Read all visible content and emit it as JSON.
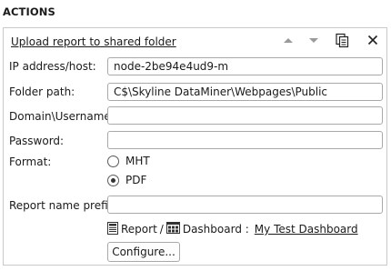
{
  "section": {
    "title": "ACTIONS"
  },
  "action": {
    "title": "Upload report to shared folder",
    "icons": {
      "move_up": "chevron-up-icon",
      "move_down": "chevron-down-icon",
      "duplicate": "copy-icon",
      "delete": "close-icon"
    },
    "icon_color_disabled": "#9a9a9a",
    "icon_color_active": "#222222"
  },
  "form": {
    "ip_label": "IP address/host:",
    "ip_value": "node-2be94e4ud9-m",
    "folder_label": "Folder path:",
    "folder_value": "C$\\Skyline DataMiner\\Webpages\\Public",
    "domain_label": "Domain\\Username:",
    "domain_value": "",
    "password_label": "Password:",
    "password_value": "",
    "format_label": "Format:",
    "format_options": [
      {
        "label": "MHT",
        "selected": false
      },
      {
        "label": "PDF",
        "selected": true
      }
    ],
    "prefix_label": "Report name prefix:",
    "prefix_value": ""
  },
  "dashboard": {
    "report_label": "Report",
    "separator": "/",
    "dashboard_label": "Dashboard :",
    "link_text": "My Test Dashboard",
    "report_icon": "report-icon",
    "dashboard_icon": "dashboard-icon"
  },
  "buttons": {
    "configure": "Configure..."
  }
}
